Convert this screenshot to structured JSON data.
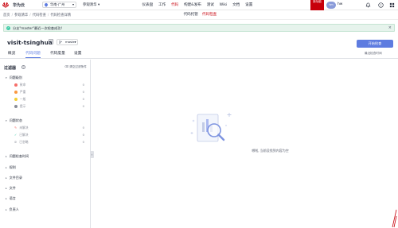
{
  "topnav": {
    "brand": "华为云",
    "region": "华南-广州",
    "project": "参观清华 ▾",
    "links": [
      "仪表盘",
      "工作",
      "代码",
      "构建&发布",
      "测试",
      "Wiki",
      "文档",
      "设置"
    ],
    "active_link_index": 2,
    "trial_badge": "新功能",
    "avatar_text": "hm",
    "username": "hw"
  },
  "breadcrumb": {
    "items": [
      "首页",
      "参观清华",
      "代码检查",
      "代码检查详情"
    ]
  },
  "subtabs": {
    "items": [
      "代码托管",
      "代码检查"
    ],
    "active_index": 1
  },
  "alert": {
    "text": "分支\"master\"最近一次检查成功!",
    "close": "×"
  },
  "repo": {
    "title": "visit-tsinghua",
    "branch": "master",
    "start_button": "开始检查",
    "right_link": "最近检查时间"
  },
  "tabs": {
    "items": [
      "概览",
      "代码问题",
      "代码度量",
      "设置"
    ],
    "active_index": 1
  },
  "filter": {
    "title": "过滤器",
    "help": "?",
    "clear": "清空过滤条件",
    "sections": [
      {
        "label": "问题级别",
        "expanded": true
      },
      {
        "label": "问题状态",
        "expanded": true
      },
      {
        "label": "问题检查时间",
        "expanded": false
      },
      {
        "label": "规则",
        "expanded": false
      },
      {
        "label": "文件目录",
        "expanded": false
      },
      {
        "label": "文件",
        "expanded": false
      },
      {
        "label": "语言",
        "expanded": false
      },
      {
        "label": "负责人",
        "expanded": false
      }
    ],
    "severity_items": [
      {
        "label": "致命",
        "count": "0",
        "color": "#f66f6a"
      },
      {
        "label": "严重",
        "count": "0",
        "color": "#fa9841"
      },
      {
        "label": "一般",
        "count": "0",
        "color": "#f3d036"
      },
      {
        "label": "提示",
        "count": "0",
        "color": "#8a8e99"
      }
    ],
    "status_items": [
      {
        "label": "未解决",
        "count": "0",
        "icon": "unresolved-icon"
      },
      {
        "label": "已解决",
        "count": "0",
        "icon": "resolved-icon"
      },
      {
        "label": "已忽略",
        "count": "0",
        "icon": "ignored-icon"
      }
    ]
  },
  "empty_state": {
    "text": "哪啦, 当前没找到内容为空"
  },
  "colors": {
    "accent": "#5e7ce0",
    "brand_red": "#c7000b",
    "alert_bg": "#e6f3ec"
  }
}
